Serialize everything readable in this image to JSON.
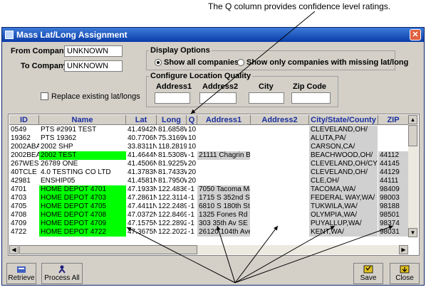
{
  "caption": "The Q column provides confidence level ratings.",
  "window": {
    "title": "Mass Lat/Long Assignment",
    "close_glyph": "✕"
  },
  "filters": {
    "from_label": "From Company:",
    "from_value": "UNKNOWN",
    "to_label": "To Company:",
    "to_value": "UNKNOWN",
    "replace_label": "Replace existing lat/longs",
    "replace_checked": false
  },
  "display_options": {
    "title": "Display Options",
    "show_all_label": "Show all companies",
    "show_missing_label": "Show only companies with missing lat/long",
    "selected": "show_all"
  },
  "quality": {
    "title": "Configure Location Quality",
    "address1_label": "Address1",
    "address2_label": "Address2",
    "city_label": "City",
    "zip_label": "Zip Code",
    "address1_value": "",
    "address2_value": "",
    "city_value": "",
    "zip_value": ""
  },
  "grid": {
    "columns": [
      "ID",
      "Name",
      "Lat",
      "Long",
      "Q",
      "Address1",
      "Address2",
      "City/State/County",
      "ZIP"
    ],
    "rows": [
      {
        "id": "0549",
        "name": "PTS #2991 TEST",
        "lat": "41.4942N",
        "long": "81.6858W",
        "q": "10",
        "addr1": "",
        "addr2": "",
        "city": "CLEVELAND,OH/",
        "zip": "",
        "name_hl": false
      },
      {
        "id": "19362",
        "name": "PTS 19362",
        "lat": "40.7706N",
        "long": "75.3169W",
        "q": "10",
        "addr1": "",
        "addr2": "",
        "city": "ALUTA,PA/",
        "zip": "",
        "name_hl": false
      },
      {
        "id": "2002ABA",
        "name": "2002 SHP",
        "lat": "33.8311N",
        "long": "118.2819W",
        "q": "10",
        "addr1": "",
        "addr2": "",
        "city": "CARSON,CA/",
        "zip": "",
        "name_hl": false
      },
      {
        "id": "2002BEA",
        "name": "2002 TEST",
        "lat": "41.4644N",
        "long": "81.5308W",
        "q": "-1",
        "addr1": "21111 Chagrin Blv",
        "addr2": "",
        "city": "BEACHWOOD,OH/",
        "zip": "44112",
        "name_hl": true
      },
      {
        "id": "267WES",
        "name": "26789 ONE",
        "lat": "41.4506N",
        "long": "81.9225W",
        "q": "20",
        "addr1": "",
        "addr2": "",
        "city": "CLEVELAND,OH/CY",
        "zip": "44145",
        "name_hl": false
      },
      {
        "id": "40TCLE",
        "name": "4.0 TESTING CO LTD",
        "lat": "41.3783N",
        "long": "81.7433W",
        "q": "20",
        "addr1": "",
        "addr2": "",
        "city": "CLEVELAND,OH/",
        "zip": "44129",
        "name_hl": false
      },
      {
        "id": "42981",
        "name": "ENSHIP05",
        "lat": "41.4581N",
        "long": "81.7950W",
        "q": "20",
        "addr1": "",
        "addr2": "",
        "city": "CLE,OH/",
        "zip": "44111",
        "name_hl": false
      },
      {
        "id": "4701",
        "name": "HOME DEPOT 4701",
        "lat": "47.1933N",
        "long": "122.4836W",
        "q": "-1",
        "addr1": "7050 Tacoma Mal",
        "addr2": "",
        "city": "TACOMA,WA/",
        "zip": "98409",
        "name_hl": true
      },
      {
        "id": "4703",
        "name": "HOME DEPOT 4703",
        "lat": "47.2861N",
        "long": "122.3114W",
        "q": "-1",
        "addr1": "1715 S 352nd St",
        "addr2": "",
        "city": "FEDERAL WAY,WA/",
        "zip": "98003",
        "name_hl": true
      },
      {
        "id": "4705",
        "name": "HOME DEPOT 4705",
        "lat": "47.4411N",
        "long": "122.2489W",
        "q": "-1",
        "addr1": "6810 S 180th St",
        "addr2": "",
        "city": "TUKWILA,WA/",
        "zip": "98188",
        "name_hl": true
      },
      {
        "id": "4708",
        "name": "HOME DEPOT 4708",
        "lat": "47.0372N",
        "long": "122.8469W",
        "q": "-1",
        "addr1": "1325 Fones Rd",
        "addr2": "",
        "city": "OLYMPIA,WA/",
        "zip": "98501",
        "name_hl": true
      },
      {
        "id": "4709",
        "name": "HOME DEPOT 4709",
        "lat": "47.1575N",
        "long": "122.2892W",
        "q": "-1",
        "addr1": "303 35th Av SE",
        "addr2": "",
        "city": "PUYALLUP,WA/",
        "zip": "98374",
        "name_hl": true
      },
      {
        "id": "4722",
        "name": "HOME DEPOT 4722",
        "lat": "47.3675N",
        "long": "122.2022W",
        "q": "-1",
        "addr1": "26120 104th Ave S",
        "addr2": "",
        "city": "KENT,WA/",
        "zip": "98031",
        "name_hl": true
      }
    ]
  },
  "buttons": {
    "retrieve": "Retrieve",
    "process_all": "Process All",
    "save": "Save",
    "close": "Close"
  },
  "colors": {
    "highlight": "#00ff00",
    "title_bar": "#0a3ca8",
    "header_text": "#1a30a0"
  }
}
